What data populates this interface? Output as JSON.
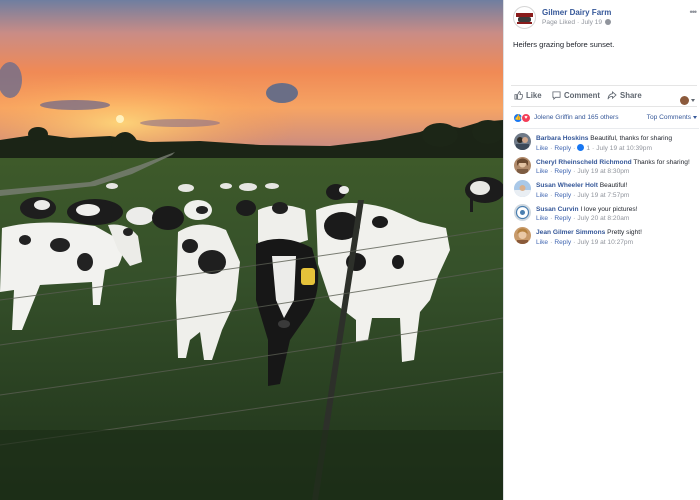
{
  "page": {
    "name": "Gilmer Dairy Farm",
    "status": "Page Liked",
    "date": "July 19",
    "privacy_icon": "globe-icon"
  },
  "post": {
    "text": "Heifers grazing before sunset.",
    "photo_subject": "sunset-pasture-photo"
  },
  "actions": {
    "like_label": "Like",
    "comment_label": "Comment",
    "share_label": "Share"
  },
  "reactions": {
    "summary": "Jolene Griffin and 165 others",
    "sort_label": "Top Comments"
  },
  "comments": [
    {
      "author": "Barbara Hoskins",
      "text": "Beautiful, thanks for sharing",
      "like": "Like",
      "reply": "Reply",
      "likes": "1",
      "time": "July 19 at 10:39pm"
    },
    {
      "author": "Cheryl Rheinscheld Richmond",
      "text": "Thanks for sharing!",
      "like": "Like",
      "reply": "Reply",
      "time": "July 19 at 8:30pm"
    },
    {
      "author": "Susan Wheeler Holt",
      "text": "Beautiful!",
      "like": "Like",
      "reply": "Reply",
      "time": "July 19 at 7:57pm"
    },
    {
      "author": "Susan Curvin",
      "text": "I love your pictures!",
      "like": "Like",
      "reply": "Reply",
      "time": "July 20 at 8:20am"
    },
    {
      "author": "Jean Gilmer Simmons",
      "text": "Pretty sight!",
      "like": "Like",
      "reply": "Reply",
      "time": "July 19 at 10:27pm"
    }
  ],
  "colors": {
    "link_blue": "#365899",
    "meta_gray": "#90949c",
    "like_blue": "#1877f2",
    "love_red": "#f33e58"
  }
}
